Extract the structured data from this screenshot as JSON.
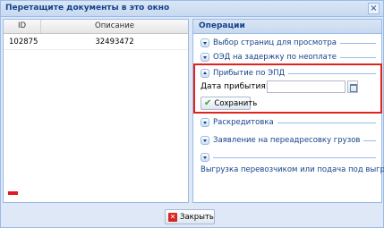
{
  "window": {
    "title": "Перетащите документы в это окно",
    "close_icon": "×"
  },
  "grid": {
    "columns": [
      "ID",
      "Описание"
    ],
    "rows": [
      {
        "id": "102875",
        "description": "32493472"
      }
    ],
    "remove_icon": "minus-icon"
  },
  "operations": {
    "title": "Операции",
    "sections": [
      {
        "label": "Выбор страниц для просмотра",
        "expanded": false
      },
      {
        "label": "ОЭД на задержку по неоплате",
        "expanded": false
      },
      {
        "label": "Прибытие по ЭПД",
        "expanded": true
      },
      {
        "label": "Раскредитовка",
        "expanded": false
      },
      {
        "label": "Заявление на переадресовку грузов",
        "expanded": false
      },
      {
        "label": "Выгрузка перевозчиком или подача под выгрузку",
        "expanded": false
      }
    ],
    "arrival": {
      "date_label": "Дата прибытия:",
      "date_value": "",
      "save_label": "Сохранить"
    }
  },
  "footer": {
    "close_label": "Закрыть"
  },
  "colors": {
    "accent": "#15428b",
    "border": "#99bbe8",
    "highlight": "#e0231d"
  }
}
